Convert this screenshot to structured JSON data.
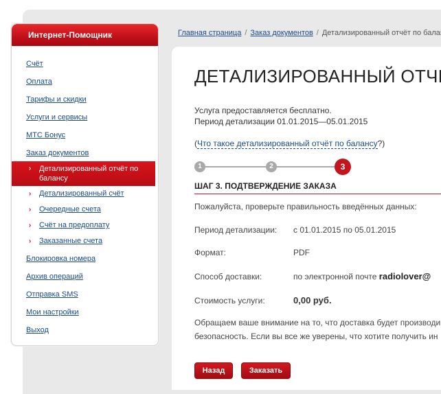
{
  "sidebar": {
    "title": "Интернет-Помощник",
    "items_top": [
      {
        "label": "Счёт"
      },
      {
        "label": "Оплата"
      },
      {
        "label": "Тарифы и скидки"
      },
      {
        "label": "Услуги и сервисы"
      },
      {
        "label": "МТС Бонус"
      },
      {
        "label": "Заказ документов"
      }
    ],
    "sub_items": [
      {
        "label": "Детализированный отчёт по балансу",
        "active": true
      },
      {
        "label": "Детализированный счёт"
      },
      {
        "label": "Очередные счета"
      },
      {
        "label": "Счёт на предоплату"
      },
      {
        "label": "Заказанные счета"
      }
    ],
    "items_bottom": [
      {
        "label": "Блокировка номера"
      },
      {
        "label": "Архив операций"
      },
      {
        "label": "Отправка SMS"
      },
      {
        "label": "Мои настройки"
      },
      {
        "label": "Выход"
      }
    ]
  },
  "breadcrumb": {
    "home": "Главная страница",
    "section": "Заказ документов",
    "current": "Детализированный отчёт по балансу"
  },
  "main": {
    "title": "ДЕТАЛИЗИРОВАННЫЙ ОТЧЁТ ПО БАЛАНСУ",
    "info_line1": "Услуга предоставляется бесплатно.",
    "info_line2": "Период детализации 01.01.2015—05.01.2015",
    "question_prefix": "(",
    "question_link": "Что такое детализированный отчёт по балансу",
    "question_suffix": "?)",
    "steps": [
      "1",
      "2",
      "3"
    ],
    "step_title": "ШАГ 3. ПОДТВЕРЖДЕНИЕ ЗАКАЗА",
    "check_text": "Пожалуйста, проверьте правильность введённых данных:",
    "rows": {
      "period_label": "Период детализации:",
      "period_value": "с 01.01.2015 по 05.01.2015",
      "format_label": "Формат:",
      "format_value": "PDF",
      "delivery_label": "Способ доставки:",
      "delivery_value_prefix": "по электронной почте",
      "delivery_email": "radiolover@",
      "cost_label": "Стоимость услуги:",
      "cost_value": "0,00 руб."
    },
    "notice_line1": "Обращаем ваше внимание на то, что доставка будет производи",
    "notice_line2": "безопасность. Если вы все же уверены, что хотите получить ин",
    "back_button": "Назад",
    "order_button": "Заказать"
  }
}
